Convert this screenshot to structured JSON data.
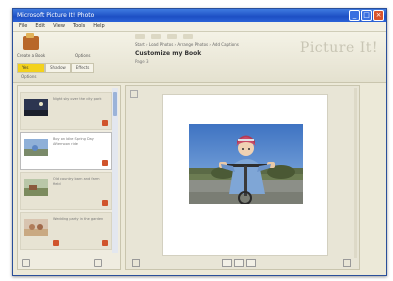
{
  "window": {
    "title": "Microsoft Picture It! Photo",
    "minimize": "_",
    "maximize": "□",
    "close": "×"
  },
  "menu": [
    "File",
    "Edit",
    "View",
    "Tools",
    "Help"
  ],
  "toolbar": {
    "left_label": "Create a Book",
    "right_label": "Options",
    "segments": [
      "Yes",
      "Shadow",
      "Effects"
    ],
    "sub_label": "Options",
    "breadcrumb": "Start  ›  Load Photos  ›  Arrange Photos  ›  Add Captions",
    "doc_title": "Customize my Book",
    "doc_sub": "Page 3",
    "logo": "Picture It!"
  },
  "sidebar": {
    "items": [
      {
        "text": "Night sky over the city park"
      },
      {
        "text": "Boy on bike Spring Day Afternoon ride",
        "selected": true
      },
      {
        "text": "Old country barn and farm field"
      },
      {
        "text": "Wedding party in the garden"
      }
    ]
  },
  "colors": {
    "accent": "#f3d21c",
    "title_bar": "#2c63d8",
    "badge": "#d0542c"
  }
}
